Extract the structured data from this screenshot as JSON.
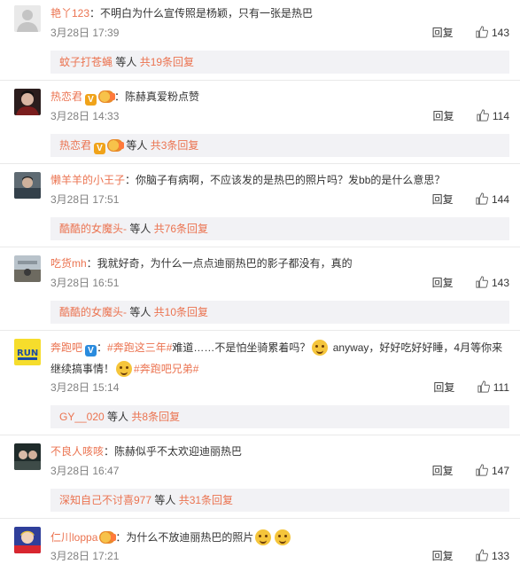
{
  "actions": {
    "reply_label": "回复"
  },
  "comments": [
    {
      "user": "艳丫123",
      "text": "：不明白为什么宣传照是杨颖，只有一张是热巴",
      "time": "3月28日 17:39",
      "likes": "143",
      "sub": {
        "who": "蚊子打苍蝇",
        "suffix": " 等人 ",
        "count": "共19条回复"
      }
    },
    {
      "user": "热恋君",
      "text": "：陈赫真爱粉点赞",
      "time": "3月28日 14:33",
      "likes": "114",
      "sub": {
        "who": "热恋君",
        "suffix": " 等人 ",
        "count": "共3条回复"
      }
    },
    {
      "user": "懒羊羊的小王子",
      "text": "：你脑子有病啊，不应该发的是热巴的照片吗？发bb的是什么意思？",
      "time": "3月28日 17:51",
      "likes": "144",
      "sub": {
        "who": "酷酷的女魔头-",
        "suffix": " 等人 ",
        "count": "共76条回复"
      }
    },
    {
      "user": "吃货mh",
      "text": "：我就好奇，为什么一点点迪丽热巴的影子都没有，真的",
      "time": "3月28日 16:51",
      "likes": "143",
      "sub": {
        "who": "酷酷的女魔头-",
        "suffix": " 等人 ",
        "count": "共10条回复"
      }
    },
    {
      "user": "奔跑吧",
      "text_a": "：",
      "tag1": "#奔跑这三年#",
      "text_b": "难道……不是怕坐骑累着吗？",
      "text_c": " anyway，好好吃好好睡，4月等你来",
      "text_d": "继续搞事情！",
      "tag2": "#奔跑吧兄弟#",
      "time": "3月28日 15:14",
      "likes": "111",
      "sub": {
        "who": "GY__020",
        "suffix": " 等人 ",
        "count": "共8条回复"
      }
    },
    {
      "user": "不良人咳咳",
      "text": "：陈赫似乎不太欢迎迪丽热巴",
      "time": "3月28日 16:47",
      "likes": "147",
      "sub": {
        "who": "深知自己不讨喜977",
        "suffix": " 等人 ",
        "count": "共31条回复"
      }
    },
    {
      "user": "仁川loppa",
      "text": "：为什么不放迪丽热巴的照片",
      "time": "3月28日 17:21",
      "likes": "133"
    }
  ]
}
